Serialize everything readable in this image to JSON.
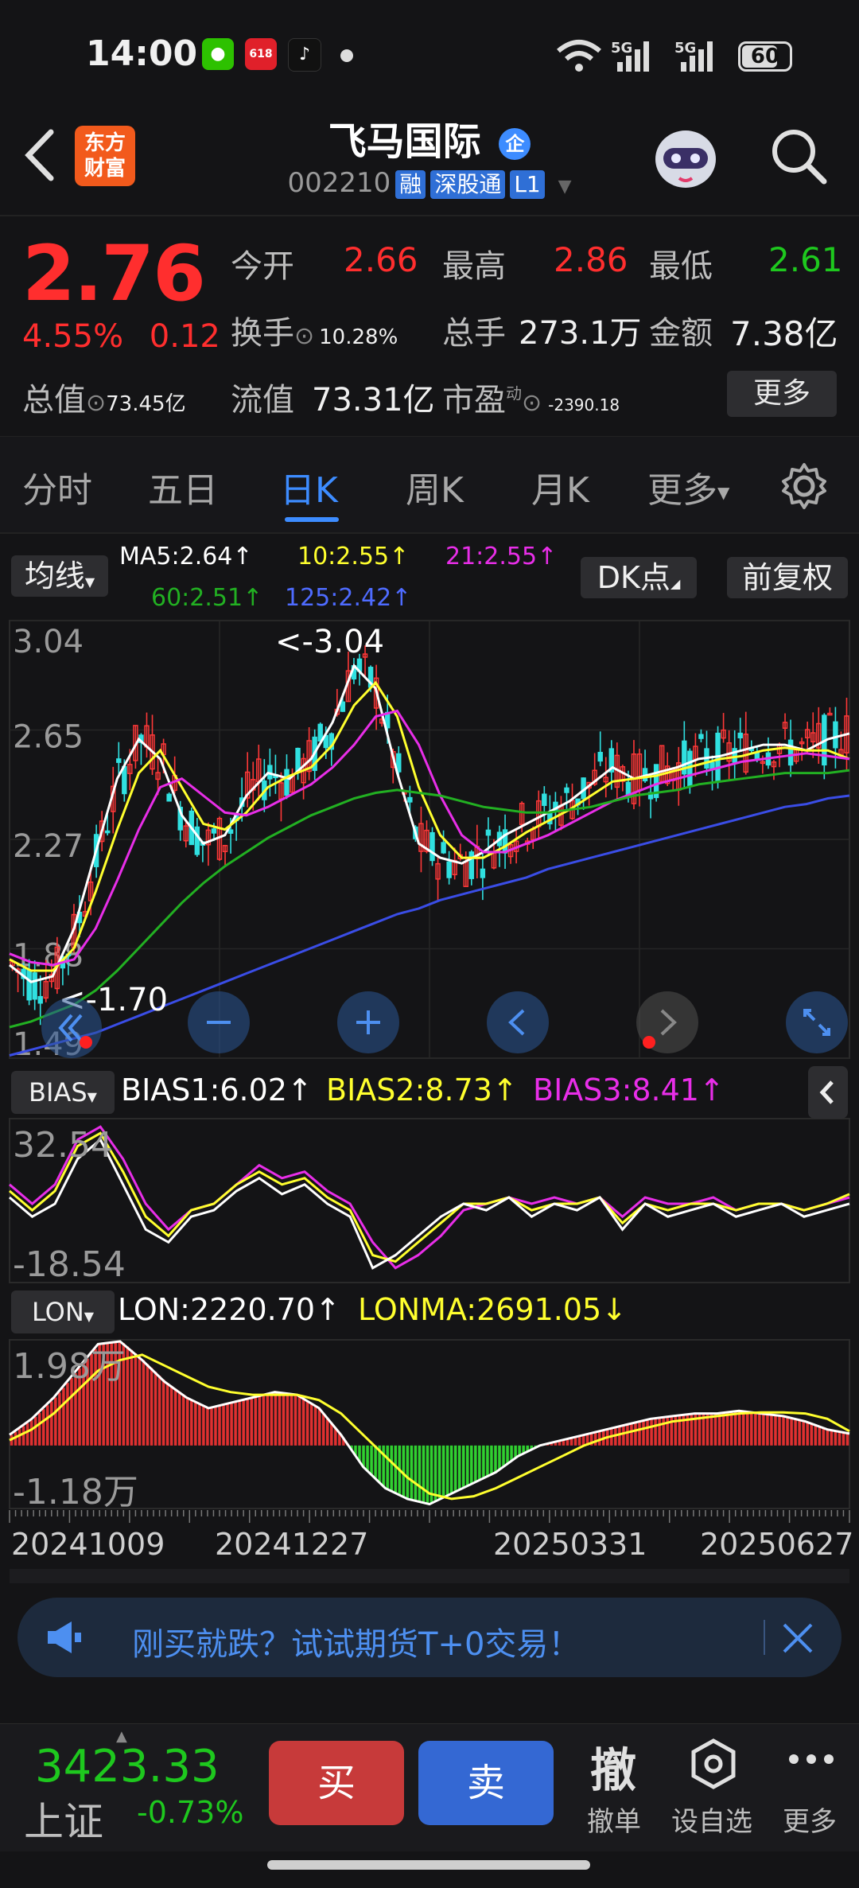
{
  "status_bar": {
    "time": "14:00",
    "signal1": "5G",
    "signal2": "5G",
    "battery": "60",
    "app_badge": "618"
  },
  "header": {
    "logo_line1": "东方",
    "logo_line2": "财富",
    "stock_name": "飞马国际",
    "name_badge": "企",
    "code": "002210",
    "tags": [
      "融",
      "深股通",
      "L1"
    ]
  },
  "quote": {
    "price": "2.76",
    "change_pct": "4.55%",
    "change": "0.12",
    "open_label": "今开",
    "open": "2.66",
    "high_label": "最高",
    "high": "2.86",
    "low_label": "最低",
    "low": "2.61",
    "turnover_label": "换手",
    "turnover": "10.28%",
    "volume_label": "总手",
    "volume": "273.1万",
    "amount_label": "金额",
    "amount": "7.38亿",
    "mktcap_label": "总值",
    "mktcap": "73.45亿",
    "float_label": "流值",
    "float_cap": "73.31亿",
    "pe_label": "市盈",
    "pe_sup": "动",
    "pe": "-2390.18",
    "more_label": "更多"
  },
  "tabs": [
    {
      "label": "分时"
    },
    {
      "label": "五日"
    },
    {
      "label": "日K"
    },
    {
      "label": "周K"
    },
    {
      "label": "月K"
    },
    {
      "label": "更多"
    }
  ],
  "active_tab": "日K",
  "chart_controls": {
    "ma_selector": "均线",
    "dk_button": "DK点",
    "adj_button": "前复权",
    "ma5": "MA5:2.64↑",
    "ma10": "10:2.55↑",
    "ma21": "21:2.55↑",
    "ma60": "60:2.51↑",
    "ma125": "125:2.42↑",
    "bias_selector": "BIAS",
    "bias1": "BIAS1:6.02↑",
    "bias2": "BIAS2:8.73↑",
    "bias3": "BIAS3:8.41↑",
    "lon_selector": "LON",
    "lon": "LON:2220.70↑",
    "lonma": "LONMA:2691.05↓"
  },
  "colors": {
    "up": "#ff2e2e",
    "down": "#1ec81e",
    "accent": "#3d8cff",
    "ma5": "#ffffff",
    "ma10": "#ffff2e",
    "ma21": "#e82ee8",
    "ma60": "#22b022",
    "ma125": "#3a4de6",
    "candle_up": "#ff3838",
    "candle_down": "#30e0e0"
  },
  "chart_data": [
    {
      "type": "line",
      "name": "daily-kline",
      "y_ticks": [
        "3.04",
        "2.65",
        "2.27",
        "1.88",
        "1.49"
      ],
      "ylim": [
        1.49,
        3.04
      ],
      "max_marker": "<-3.04",
      "min_marker": "<-1.70",
      "x_ticks": [
        "20241009",
        "20241227",
        "20250331",
        "20250627"
      ],
      "series": [
        {
          "name": "MA5",
          "values": [
            1.82,
            1.76,
            1.78,
            1.95,
            2.22,
            2.48,
            2.62,
            2.55,
            2.35,
            2.25,
            2.28,
            2.42,
            2.5,
            2.48,
            2.55,
            2.68,
            2.88,
            2.8,
            2.5,
            2.25,
            2.2,
            2.18,
            2.22,
            2.28,
            2.32,
            2.36,
            2.4,
            2.46,
            2.52,
            2.48,
            2.5,
            2.52,
            2.55,
            2.56,
            2.58,
            2.6,
            2.6,
            2.58,
            2.62,
            2.64
          ]
        },
        {
          "name": "MA10",
          "values": [
            1.84,
            1.8,
            1.8,
            1.88,
            2.08,
            2.3,
            2.5,
            2.58,
            2.45,
            2.32,
            2.3,
            2.36,
            2.45,
            2.49,
            2.52,
            2.6,
            2.74,
            2.82,
            2.7,
            2.45,
            2.28,
            2.2,
            2.2,
            2.24,
            2.29,
            2.33,
            2.37,
            2.42,
            2.47,
            2.48,
            2.49,
            2.51,
            2.53,
            2.55,
            2.56,
            2.58,
            2.59,
            2.58,
            2.58,
            2.55
          ]
        },
        {
          "name": "21",
          "values": [
            1.86,
            1.83,
            1.82,
            1.84,
            1.95,
            2.12,
            2.3,
            2.45,
            2.48,
            2.42,
            2.36,
            2.35,
            2.38,
            2.42,
            2.46,
            2.52,
            2.6,
            2.7,
            2.72,
            2.6,
            2.42,
            2.28,
            2.22,
            2.22,
            2.25,
            2.28,
            2.32,
            2.36,
            2.4,
            2.43,
            2.46,
            2.48,
            2.5,
            2.52,
            2.54,
            2.55,
            2.56,
            2.57,
            2.56,
            2.55
          ]
        },
        {
          "name": "60",
          "values": [
            1.6,
            1.62,
            1.65,
            1.68,
            1.73,
            1.8,
            1.88,
            1.96,
            2.04,
            2.11,
            2.17,
            2.22,
            2.27,
            2.31,
            2.35,
            2.38,
            2.41,
            2.43,
            2.44,
            2.43,
            2.42,
            2.4,
            2.38,
            2.37,
            2.36,
            2.36,
            2.37,
            2.38,
            2.4,
            2.42,
            2.43,
            2.44,
            2.46,
            2.47,
            2.48,
            2.49,
            2.5,
            2.5,
            2.5,
            2.51
          ]
        },
        {
          "name": "125",
          "values": [
            1.5,
            1.52,
            1.54,
            1.56,
            1.58,
            1.61,
            1.64,
            1.67,
            1.7,
            1.73,
            1.76,
            1.79,
            1.82,
            1.85,
            1.88,
            1.91,
            1.94,
            1.97,
            2.0,
            2.02,
            2.05,
            2.07,
            2.09,
            2.11,
            2.13,
            2.16,
            2.18,
            2.2,
            2.22,
            2.24,
            2.26,
            2.28,
            2.3,
            2.32,
            2.34,
            2.36,
            2.38,
            2.39,
            2.41,
            2.42
          ]
        }
      ]
    },
    {
      "type": "line",
      "name": "bias",
      "y_ticks": [
        "32.54",
        "-18.54"
      ],
      "ylim": [
        -18.54,
        32.54
      ],
      "series": [
        {
          "name": "BIAS1",
          "values": [
            8,
            2,
            6,
            20,
            26,
            12,
            -2,
            -6,
            2,
            4,
            10,
            14,
            9,
            12,
            6,
            2,
            -14,
            -10,
            -4,
            2,
            6,
            4,
            8,
            2,
            6,
            4,
            8,
            -2,
            6,
            2,
            4,
            6,
            2,
            4,
            6,
            2,
            4,
            6
          ]
        },
        {
          "name": "BIAS2",
          "values": [
            10,
            4,
            10,
            24,
            28,
            16,
            2,
            -4,
            4,
            6,
            12,
            16,
            12,
            14,
            8,
            4,
            -10,
            -12,
            -6,
            0,
            6,
            6,
            8,
            4,
            6,
            6,
            8,
            0,
            6,
            4,
            6,
            6,
            4,
            6,
            6,
            4,
            6,
            9
          ]
        },
        {
          "name": "BIAS3",
          "values": [
            12,
            6,
            12,
            26,
            30,
            20,
            6,
            -2,
            4,
            6,
            12,
            18,
            14,
            16,
            10,
            6,
            -6,
            -14,
            -10,
            -4,
            4,
            6,
            8,
            6,
            8,
            6,
            8,
            2,
            8,
            6,
            6,
            8,
            4,
            6,
            6,
            4,
            6,
            8
          ]
        }
      ]
    },
    {
      "type": "bar",
      "name": "lon",
      "y_ticks": [
        "1.98万",
        "-1.18万"
      ],
      "ylim": [
        -11800,
        19800
      ],
      "series": [
        {
          "name": "LON",
          "values": [
            2000,
            5000,
            9000,
            14000,
            19000,
            19500,
            16000,
            12000,
            9000,
            7000,
            8000,
            9000,
            10000,
            9500,
            7000,
            2000,
            -4000,
            -8000,
            -10000,
            -11000,
            -9000,
            -7000,
            -5000,
            -2000,
            0,
            1000,
            2000,
            3000,
            4000,
            5000,
            5500,
            6000,
            6000,
            6500,
            6000,
            5500,
            4500,
            3000,
            2220
          ]
        },
        {
          "name": "LONMA",
          "values": [
            1000,
            3000,
            6000,
            10000,
            14000,
            16000,
            17000,
            15000,
            13000,
            11000,
            10000,
            9500,
            9500,
            9500,
            8500,
            6000,
            2000,
            -2000,
            -6000,
            -9000,
            -10000,
            -9500,
            -8000,
            -6000,
            -4000,
            -2000,
            0,
            1500,
            2500,
            3500,
            4500,
            5000,
            5500,
            6000,
            6200,
            6200,
            6000,
            5000,
            2691
          ]
        }
      ]
    }
  ],
  "banner": {
    "text": "刚买就跌？试试期货T+0交易！"
  },
  "bottom_bar": {
    "index_value": "3423.33",
    "index_name": "上证",
    "index_pct": "-0.73%",
    "buy_label": "买",
    "sell_label": "卖",
    "revoke_icon_text": "撤",
    "revoke_label": "撤单",
    "watch_label": "设自选",
    "more_label": "更多"
  }
}
